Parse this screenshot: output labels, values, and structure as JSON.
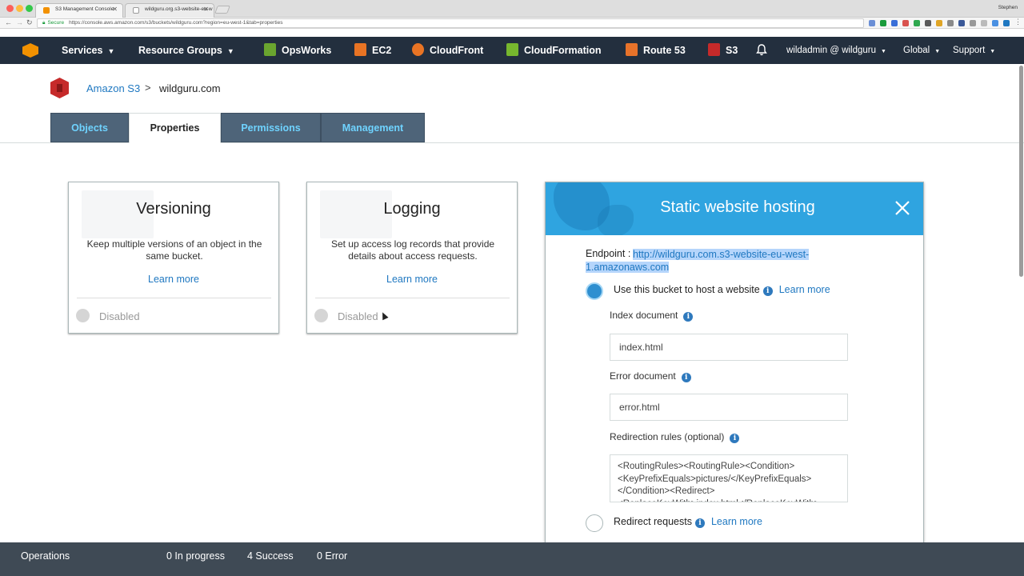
{
  "browser": {
    "tabs": [
      {
        "title": "S3 Management Console",
        "favicon_color": "#f29100"
      },
      {
        "title": "wildguru.org.s3-website-eu-w",
        "favicon_color": "#9a9a9a"
      }
    ],
    "profile": "Stephen",
    "url_secure": "Secure",
    "url": "https://console.aws.amazon.com/s3/buckets/wildguru.com?region=eu-west-1&tab=properties"
  },
  "nav": {
    "services": "Services",
    "resource_groups": "Resource Groups",
    "opsworks": "OpsWorks",
    "ec2": "EC2",
    "cloudfront": "CloudFront",
    "cloudformation": "CloudFormation",
    "route53": "Route 53",
    "s3": "S3",
    "account": "wildadmin @ wildguru",
    "region": "Global",
    "support": "Support",
    "colors": {
      "bar": "#232f3e",
      "opsworks": "#6aa52f",
      "ec2": "#e97424",
      "cloudfront": "#e97424",
      "cloudformation": "#77b72e",
      "route53": "#e8732a",
      "s3": "#c62a2a"
    }
  },
  "breadcrumb": {
    "root": "Amazon S3",
    "separator": ">",
    "current": "wildguru.com"
  },
  "tabs": {
    "objects": "Objects",
    "properties": "Properties",
    "permissions": "Permissions",
    "management": "Management",
    "active": "Properties"
  },
  "cards": {
    "versioning": {
      "title": "Versioning",
      "description": "Keep multiple versions of an object in the same bucket.",
      "learn_more": "Learn more",
      "status": "Disabled"
    },
    "logging": {
      "title": "Logging",
      "description": "Set up access log records that provide details about access requests.",
      "learn_more": "Learn more",
      "status": "Disabled"
    }
  },
  "hosting": {
    "title": "Static website hosting",
    "endpoint_label": "Endpoint :",
    "endpoint_url": "http://wildguru.com.s3-website-eu-west-1.amazonaws.com",
    "option_host": "Use this bucket to host a website",
    "learn_more": "Learn more",
    "index_label": "Index document",
    "index_value": "index.html",
    "error_label": "Error document",
    "error_value": "error.html",
    "redirect_rules_label": "Redirection rules (optional)",
    "redirect_rules_value": "<RoutingRules><RoutingRule><Condition><KeyPrefixEquals>pictures/</KeyPrefixEquals></Condition><Redirect><ReplaceKeyWith>index.html</ReplaceKeyWith></Redirect></RoutingRule></RoutingRules>",
    "option_redirect": "Redirect requests",
    "selected_option": "host",
    "header_color": "#2fa4e0"
  },
  "operations": {
    "label": "Operations",
    "in_progress": "0 In progress",
    "success": "4 Success",
    "error": "0 Error"
  }
}
